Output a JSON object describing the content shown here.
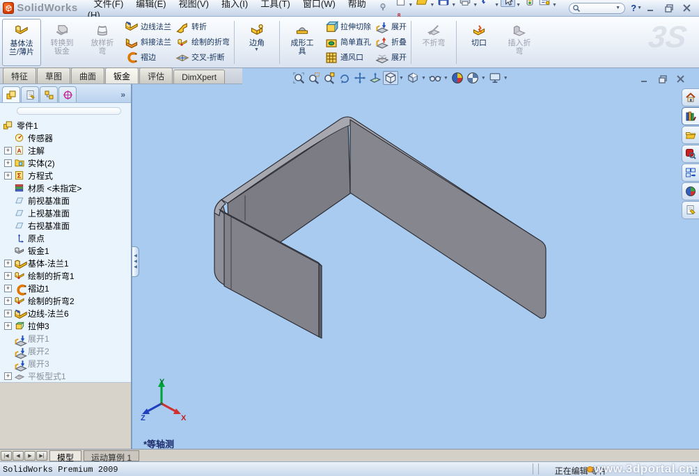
{
  "window": {
    "brand": "SolidWorks",
    "menus": [
      "文件(F)",
      "编辑(E)",
      "视图(V)",
      "插入(I)",
      "工具(T)",
      "窗口(W)",
      "帮助(H)"
    ],
    "quick_tools": [
      {
        "name": "new-document",
        "dropdown": true
      },
      {
        "name": "open",
        "dropdown": true
      },
      {
        "name": "save",
        "dropdown": true
      },
      {
        "name": "print",
        "dropdown": true
      },
      {
        "name": "undo",
        "dropdown": true
      },
      {
        "name": "select-arrow",
        "dropdown": true,
        "pressed": true
      },
      {
        "name": "rebuild",
        "dropdown": false
      },
      {
        "name": "options-list",
        "dropdown": true
      },
      {
        "name": "quick-extra",
        "dropdown": false
      }
    ],
    "help": "?",
    "controls": [
      "minimize",
      "restore",
      "close"
    ]
  },
  "ribbon": {
    "logo": "3S",
    "separators_after": [
      2,
      3,
      6,
      7
    ],
    "groups": [
      {
        "type": "big",
        "buttons": [
          {
            "label": "基体法兰/薄片",
            "lines": [
              "基体法",
              "兰/薄片"
            ],
            "icon": "base-flange",
            "enabled": true,
            "active": true
          },
          {
            "label": "转换到钣金",
            "lines": [
              "转换到",
              "钣金"
            ],
            "icon": "convert-to-sheetmetal",
            "enabled": false
          },
          {
            "label": "放样折弯",
            "lines": [
              "放样折",
              "弯"
            ],
            "icon": "lofted-bend",
            "enabled": false
          }
        ]
      },
      {
        "type": "stack",
        "buttons": [
          {
            "label": "边线法兰",
            "icon": "edge-flange",
            "enabled": true
          },
          {
            "label": "斜接法兰",
            "icon": "miter-flange",
            "enabled": true
          },
          {
            "label": "褶边",
            "icon": "hem",
            "enabled": true
          }
        ]
      },
      {
        "type": "stack",
        "buttons": [
          {
            "label": "转折",
            "icon": "jog",
            "enabled": true
          },
          {
            "label": "绘制的折弯",
            "icon": "sketched-bend",
            "enabled": true
          },
          {
            "label": "交叉-折断",
            "icon": "cross-break",
            "enabled": true
          }
        ]
      },
      {
        "type": "big",
        "buttons": [
          {
            "label": "边角",
            "lines": [
              "边角"
            ],
            "icon": "corner",
            "enabled": true,
            "dropdown": true
          }
        ]
      },
      {
        "type": "big",
        "buttons": [
          {
            "label": "成形工具",
            "lines": [
              "成形工",
              "具"
            ],
            "icon": "forming-tool",
            "enabled": true
          }
        ]
      },
      {
        "type": "stack",
        "buttons": [
          {
            "label": "拉伸切除",
            "icon": "extruded-cut",
            "enabled": true
          },
          {
            "label": "简单直孔",
            "icon": "simple-hole",
            "enabled": true
          },
          {
            "label": "通风口",
            "icon": "vent",
            "enabled": true
          }
        ]
      },
      {
        "type": "stack",
        "buttons": [
          {
            "label": "展开",
            "icon": "unfold",
            "enabled": true
          },
          {
            "label": "折叠",
            "icon": "fold",
            "enabled": true
          },
          {
            "label": "展开",
            "icon": "flatten",
            "enabled": true
          }
        ]
      },
      {
        "type": "big",
        "buttons": [
          {
            "label": "不折弯",
            "lines": [
              "不折弯"
            ],
            "icon": "no-bends",
            "enabled": false
          }
        ]
      },
      {
        "type": "big",
        "buttons": [
          {
            "label": "切口",
            "lines": [
              "切口"
            ],
            "icon": "rip",
            "enabled": true
          }
        ]
      },
      {
        "type": "big",
        "buttons": [
          {
            "label": "插入折弯",
            "lines": [
              "插入折",
              "弯"
            ],
            "icon": "insert-bends",
            "enabled": false
          }
        ]
      }
    ]
  },
  "command_tabs": [
    {
      "label": "特征",
      "active": false
    },
    {
      "label": "草图",
      "active": false
    },
    {
      "label": "曲面",
      "active": false
    },
    {
      "label": "钣金",
      "active": true
    },
    {
      "label": "评估",
      "active": false
    },
    {
      "label": "DimXpert",
      "active": false
    }
  ],
  "feature_tree": {
    "items": [
      {
        "label": "零件1",
        "icon": "part",
        "root": true,
        "expander": false,
        "grayed": false
      },
      {
        "label": "传感器",
        "icon": "sensors",
        "expander": false,
        "grayed": false
      },
      {
        "label": "注解",
        "icon": "annotations",
        "expander": true,
        "grayed": false
      },
      {
        "label": "实体(2)",
        "icon": "solid-bodies",
        "expander": true,
        "grayed": false
      },
      {
        "label": "方程式",
        "icon": "equations",
        "expander": true,
        "grayed": false
      },
      {
        "label": "材质 <未指定>",
        "icon": "material",
        "expander": false,
        "grayed": false
      },
      {
        "label": "前视基准面",
        "icon": "plane",
        "expander": false,
        "grayed": false
      },
      {
        "label": "上视基准面",
        "icon": "plane",
        "expander": false,
        "grayed": false
      },
      {
        "label": "右视基准面",
        "icon": "plane",
        "expander": false,
        "grayed": false
      },
      {
        "label": "原点",
        "icon": "origin",
        "expander": false,
        "grayed": false
      },
      {
        "label": "钣金1",
        "icon": "sheet-metal",
        "expander": false,
        "grayed": false
      },
      {
        "label": "基体-法兰1",
        "icon": "base-flange",
        "expander": true,
        "grayed": false
      },
      {
        "label": "绘制的折弯1",
        "icon": "sketched-bend",
        "expander": true,
        "grayed": false
      },
      {
        "label": "褶边1",
        "icon": "hem",
        "expander": true,
        "grayed": false
      },
      {
        "label": "绘制的折弯2",
        "icon": "sketched-bend",
        "expander": true,
        "grayed": false
      },
      {
        "label": "边线-法兰6",
        "icon": "edge-flange",
        "expander": true,
        "grayed": false
      },
      {
        "label": "拉伸3",
        "icon": "extrude",
        "expander": true,
        "grayed": false
      },
      {
        "label": "展开1",
        "icon": "unfold",
        "expander": false,
        "grayed": true
      },
      {
        "label": "展开2",
        "icon": "unfold",
        "expander": false,
        "grayed": true
      },
      {
        "label": "展开3",
        "icon": "unfold",
        "expander": false,
        "grayed": true
      },
      {
        "label": "平板型式1",
        "icon": "flat-pattern",
        "expander": true,
        "grayed": true
      }
    ]
  },
  "headsup": [
    {
      "name": "zoom-to-fit-icon",
      "dropdown": false
    },
    {
      "name": "zoom-to-area-icon",
      "dropdown": false
    },
    {
      "name": "zoom-to-selection-icon",
      "dropdown": false
    },
    {
      "name": "rotate-view-icon",
      "dropdown": false
    },
    {
      "name": "pan-icon",
      "dropdown": false
    },
    {
      "name": "section-view-icon",
      "dropdown": false
    },
    {
      "name": "view-orientation-icon",
      "dropdown": true,
      "pressed": true
    },
    {
      "name": "display-style-icon",
      "dropdown": true
    },
    {
      "name": "hide-show-items-icon",
      "dropdown": true
    },
    {
      "name": "edit-appearance-icon",
      "dropdown": false
    },
    {
      "name": "apply-scene-icon",
      "dropdown": true
    },
    {
      "name": "view-settings-icon",
      "dropdown": true
    }
  ],
  "viewport": {
    "view_label": "*等轴测",
    "triad": {
      "x": "X",
      "y": "Y",
      "z": "Z"
    },
    "doc_controls": [
      "minimize",
      "restore",
      "close"
    ]
  },
  "task_pane": [
    {
      "name": "solidworks-resources",
      "active": false
    },
    {
      "name": "design-library",
      "active": true
    },
    {
      "name": "file-explorer",
      "active": false
    },
    {
      "name": "solidworks-search",
      "active": false
    },
    {
      "name": "view-palette",
      "active": false
    },
    {
      "name": "appearances-scenes",
      "active": false
    },
    {
      "name": "custom-properties",
      "active": false
    }
  ],
  "bottom_bar": {
    "vcr": [
      "|◀",
      "◀",
      "▶",
      "▶|"
    ],
    "tabs": [
      {
        "label": "模型",
        "active": true
      },
      {
        "label": "运动算例 1",
        "active": false
      }
    ]
  },
  "status_bar": {
    "left": "SolidWorks Premium 2009",
    "editing": "正在编辑 零件",
    "watermark": "www.3dportal.cn"
  },
  "colors": {
    "viewport_bg": "#A9CBEF",
    "model_face": "#85858D",
    "model_rim": "#A7A7AF",
    "model_edge": "#2E2E36",
    "title_bg": "#D9E4F2",
    "panel_bg": "#E9F4FC"
  }
}
